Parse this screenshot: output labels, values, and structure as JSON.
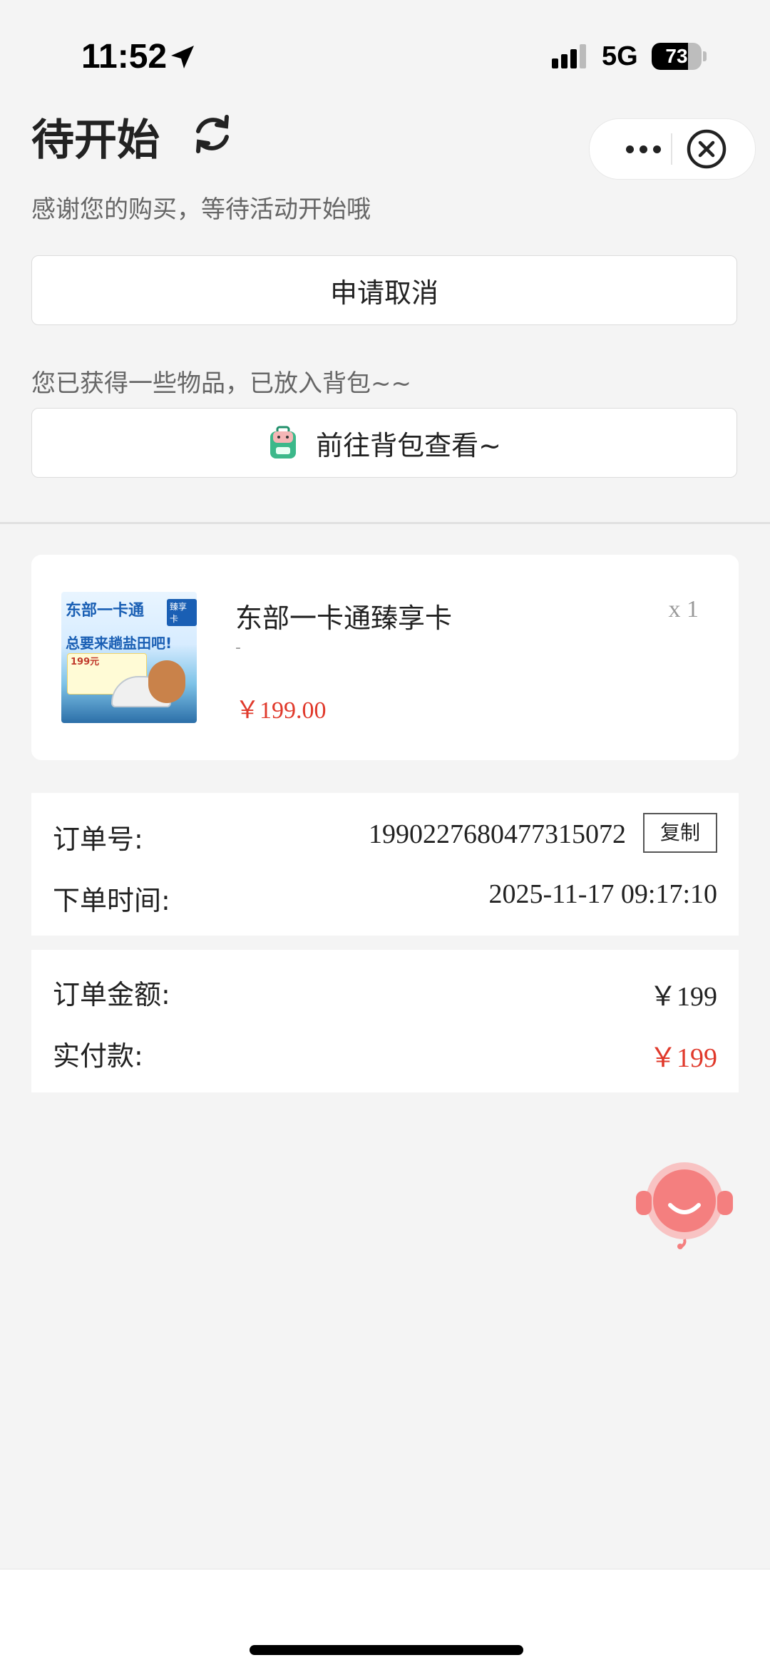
{
  "status_bar": {
    "time": "11:52",
    "network": "5G",
    "battery": "73",
    "battery_level": 0.73
  },
  "header": {
    "title": "待开始",
    "subtitle": "感谢您的购买，等待活动开始哦",
    "cancel_button": "申请取消",
    "backpack_hint": "您已获得一些物品，已放入背包~~",
    "backpack_button": "前往背包查看~"
  },
  "product": {
    "name": "东部一卡通臻享卡",
    "spec": "-",
    "quantity": "x 1",
    "price": "￥199.00",
    "thumbnail": {
      "title": "东部一卡通",
      "tag": "臻享卡",
      "slogan": "总要来趟盐田吧!",
      "badge": "199元"
    }
  },
  "order_info": {
    "order_no_label": "订单号:",
    "order_no": "1990227680477315072",
    "copy_button": "复制",
    "time_label": "下单时间:",
    "time": "2025-11-17 09:17:10"
  },
  "amount": {
    "total_label": "订单金额:",
    "total": "￥199",
    "paid_label": "实付款:",
    "paid": "￥199"
  },
  "colors": {
    "accent_red": "#e0392b",
    "background": "#f4f4f4"
  }
}
